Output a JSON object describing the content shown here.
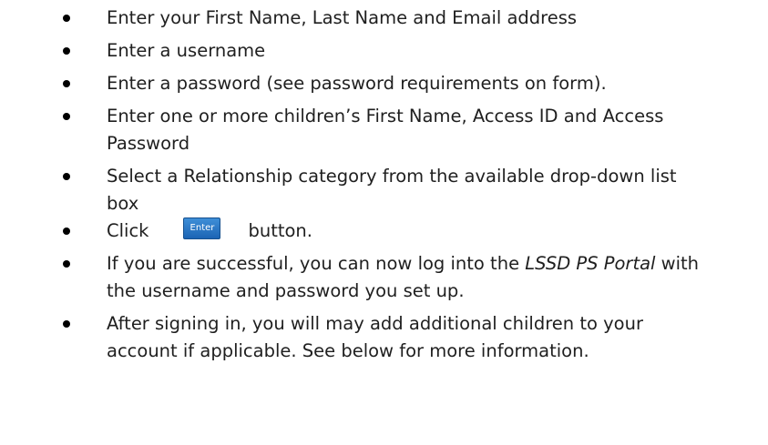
{
  "instructions": [
    {
      "text": "Enter your First Name, Last Name and Email address"
    },
    {
      "text": "Enter a username"
    },
    {
      "text": "Enter a password (see password requirements on form)."
    },
    {
      "line1": "Enter one or more children’s First Name, Access ID and Access",
      "line2": "Password"
    },
    {
      "line1": "Select a Relationship category from the available drop-down list",
      "line2": "box"
    },
    {
      "before": "Click",
      "button_label": "Enter",
      "after": "button."
    },
    {
      "line1_before": "If you are successful, you can now log into the ",
      "line1_emphasis": "LSSD PS Portal",
      "line1_after": " with",
      "line2": "the username and password you set up."
    },
    {
      "line1": "After signing in, you will may add additional children to your",
      "line2": "account if applicable. See below for more information."
    }
  ]
}
